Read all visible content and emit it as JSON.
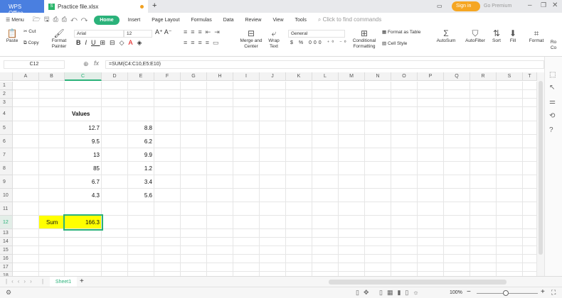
{
  "titlebar": {
    "app": "WPS Office",
    "file": "Practice file.xlsx",
    "new_tab": "+",
    "sign_in": "Sign in",
    "premium": "Go Premium"
  },
  "menu": {
    "menu_label": "Menu",
    "tabs": [
      "Home",
      "Insert",
      "Page Layout",
      "Formulas",
      "Data",
      "Review",
      "View",
      "Tools"
    ],
    "search_placeholder": "Click to find commands"
  },
  "ribbon": {
    "paste": "Paste",
    "cut": "Cut",
    "copy": "Copy",
    "format_painter": "Format Painter",
    "font": "Arial",
    "size": "12",
    "merge": "Merge and Center",
    "wrap": "Wrap Text",
    "number_format": "General",
    "conditional": "Conditional Formatting",
    "format_table": "Format as Table",
    "cell_style": "Cell Style",
    "autosum": "AutoSum",
    "autofilter": "AutoFilter",
    "sort": "Sort",
    "fill": "Fill",
    "format": "Format",
    "rowcol": "Ro Co"
  },
  "formula_bar": {
    "name_box": "C12",
    "fx": "fx",
    "formula": "=SUM(C4:C10,E5:E10)"
  },
  "grid": {
    "columns": [
      "A",
      "B",
      "C",
      "D",
      "E",
      "F",
      "G",
      "H",
      "I",
      "J",
      "K",
      "L",
      "M",
      "N",
      "O",
      "P",
      "Q",
      "R",
      "S",
      "T"
    ],
    "rows": [
      "1",
      "2",
      "3",
      "4",
      "5",
      "6",
      "7",
      "8",
      "9",
      "10",
      "11",
      "12",
      "13",
      "14",
      "15",
      "16",
      "17",
      "18"
    ],
    "selected_cell": "C12",
    "cells": [
      {
        "ref": "C4",
        "v": "Values",
        "bold": true,
        "align": "left"
      },
      {
        "ref": "C5",
        "v": "12.7"
      },
      {
        "ref": "E5",
        "v": "8.8"
      },
      {
        "ref": "C6",
        "v": "9.5"
      },
      {
        "ref": "E6",
        "v": "6.2"
      },
      {
        "ref": "C7",
        "v": "13"
      },
      {
        "ref": "E7",
        "v": "9.9"
      },
      {
        "ref": "C8",
        "v": "85"
      },
      {
        "ref": "E8",
        "v": "1.2"
      },
      {
        "ref": "C9",
        "v": "6.7"
      },
      {
        "ref": "E9",
        "v": "3.4"
      },
      {
        "ref": "C10",
        "v": "4.3"
      },
      {
        "ref": "E10",
        "v": "5.6"
      },
      {
        "ref": "B12",
        "v": "Sum",
        "align": "left",
        "fill": "#ffff00"
      },
      {
        "ref": "C12",
        "v": "166.3",
        "fill": "#ffff00"
      }
    ]
  },
  "sheets": {
    "tabs": [
      "Sheet1"
    ],
    "add": "+"
  },
  "status": {
    "zoom": "100%"
  },
  "colors": {
    "accent": "#2bb27a",
    "highlight": "#ffff00",
    "wps_blue": "#4a7fe0",
    "signin": "#f5a623"
  }
}
